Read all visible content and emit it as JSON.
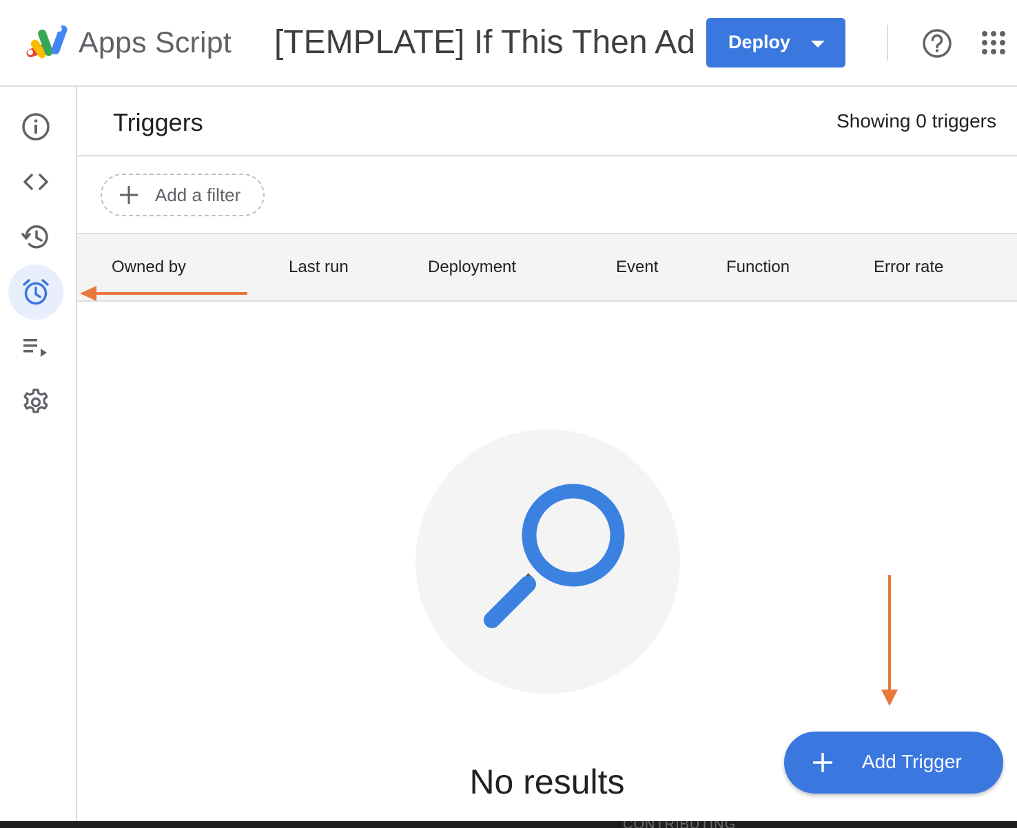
{
  "header": {
    "app_name": "Apps Script",
    "project_title": "[TEMPLATE] If This Then Ad",
    "deploy_label": "Deploy",
    "icons": [
      "apps-script-logo",
      "help-icon",
      "apps-grid-icon",
      "dropdown-caret-icon"
    ]
  },
  "sidebar": {
    "items": [
      {
        "name": "overview",
        "icon": "info-icon"
      },
      {
        "name": "editor",
        "icon": "code-icon"
      },
      {
        "name": "executions-history",
        "icon": "history-icon"
      },
      {
        "name": "triggers",
        "icon": "alarm-clock-icon",
        "active": true
      },
      {
        "name": "executions",
        "icon": "playlist-play-icon"
      },
      {
        "name": "settings",
        "icon": "gear-icon"
      }
    ]
  },
  "main": {
    "title": "Triggers",
    "count_text": "Showing 0 triggers",
    "filter_label": "Add a filter",
    "columns": [
      "Owned by",
      "Last run",
      "Deployment",
      "Event",
      "Function",
      "Error rate"
    ],
    "empty_text": "No results",
    "add_trigger_label": "Add Trigger"
  },
  "footer": {
    "partial_text": "CONTRIBUTING"
  },
  "colors": {
    "primary": "#3a78e0",
    "annotation": "#e8783a",
    "active_rail_bg": "#e8eefc",
    "magnifier": "#3b82e0"
  }
}
